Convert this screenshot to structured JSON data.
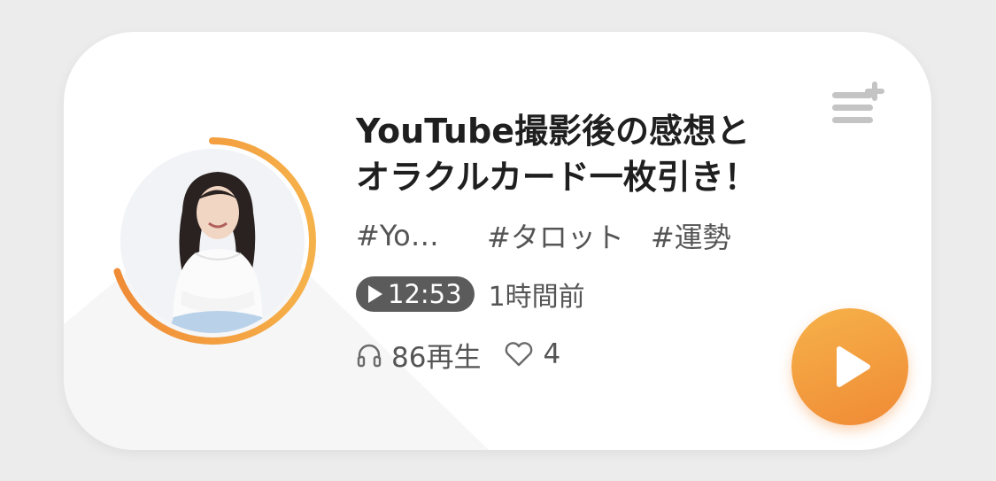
{
  "episode": {
    "title_line1": "YouTube撮影後の感想と",
    "title_line2": "オラクルカード一枚引き！",
    "tags": [
      "#Yo…",
      "#タロット",
      "#運勢"
    ],
    "duration": "12:53",
    "posted": "1時間前",
    "plays": "86再生",
    "likes": "4",
    "progress_fraction": 0.7
  },
  "colors": {
    "accent_start": "#f6b24a",
    "accent_end": "#f08a35",
    "text_primary": "#1f1f1f",
    "text_secondary": "#555555",
    "badge_bg": "#5b5b5b",
    "icon_gray": "#c4c4c4"
  },
  "icons": {
    "playlist_add": "playlist-add-icon",
    "play": "play-icon",
    "headphones": "headphones-icon",
    "heart": "heart-icon"
  }
}
